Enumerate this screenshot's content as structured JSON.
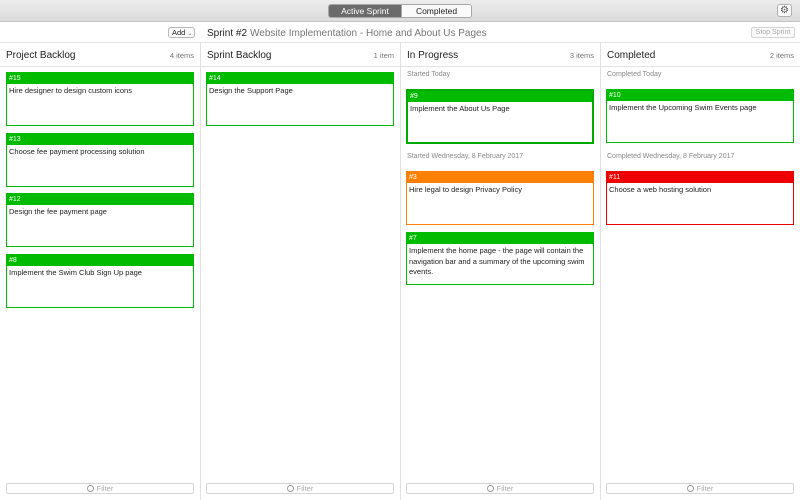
{
  "toolbar": {
    "tabs": [
      "Active Sprint",
      "Completed Sprints"
    ],
    "settings_icon": "gear-icon"
  },
  "subbar": {
    "add_label": "Add",
    "sprint_title": "Sprint #2",
    "sprint_subtitle": "Website Implementation - Home and About Us Pages",
    "stop_label": "Stop Sprint"
  },
  "colors": {
    "green": "#00bb00",
    "orange": "#ff8000",
    "red": "#ee0000"
  },
  "columns": {
    "backlog": {
      "title": "Project Backlog",
      "count": "4 items",
      "cards": [
        {
          "id": "#15",
          "text": "Hire designer to design custom icons"
        },
        {
          "id": "#13",
          "text": "Choose fee payment processing solution"
        },
        {
          "id": "#12",
          "text": "Design the fee payment page"
        },
        {
          "id": "#8",
          "text": "Implement the Swim Club Sign Up page"
        }
      ]
    },
    "sprint": {
      "title": "Sprint Backlog",
      "count": "1 item",
      "cards": [
        {
          "id": "#14",
          "text": "Design the Support Page"
        }
      ]
    },
    "progress": {
      "title": "In Progress",
      "count": "3 items",
      "section1": "Started Today",
      "section2": "Started Wednesday, 8 February 2017",
      "cards": [
        {
          "id": "#9",
          "text": "Implement the About Us Page"
        },
        {
          "id": "#3",
          "text": "Hire legal to design Privacy Policy"
        },
        {
          "id": "#7",
          "text": "Implement the home page - the page will contain the navigation bar and a summary of the upcoming swim events."
        }
      ]
    },
    "completed": {
      "title": "Completed",
      "count": "2 items",
      "section1": "Completed Today",
      "section2": "Completed Wednesday, 8 February 2017",
      "cards": [
        {
          "id": "#10",
          "text": "Implement the Upcoming Swim Events page"
        },
        {
          "id": "#11",
          "text": "Choose a web hosting solution"
        }
      ]
    }
  },
  "filter_placeholder": "Filter"
}
